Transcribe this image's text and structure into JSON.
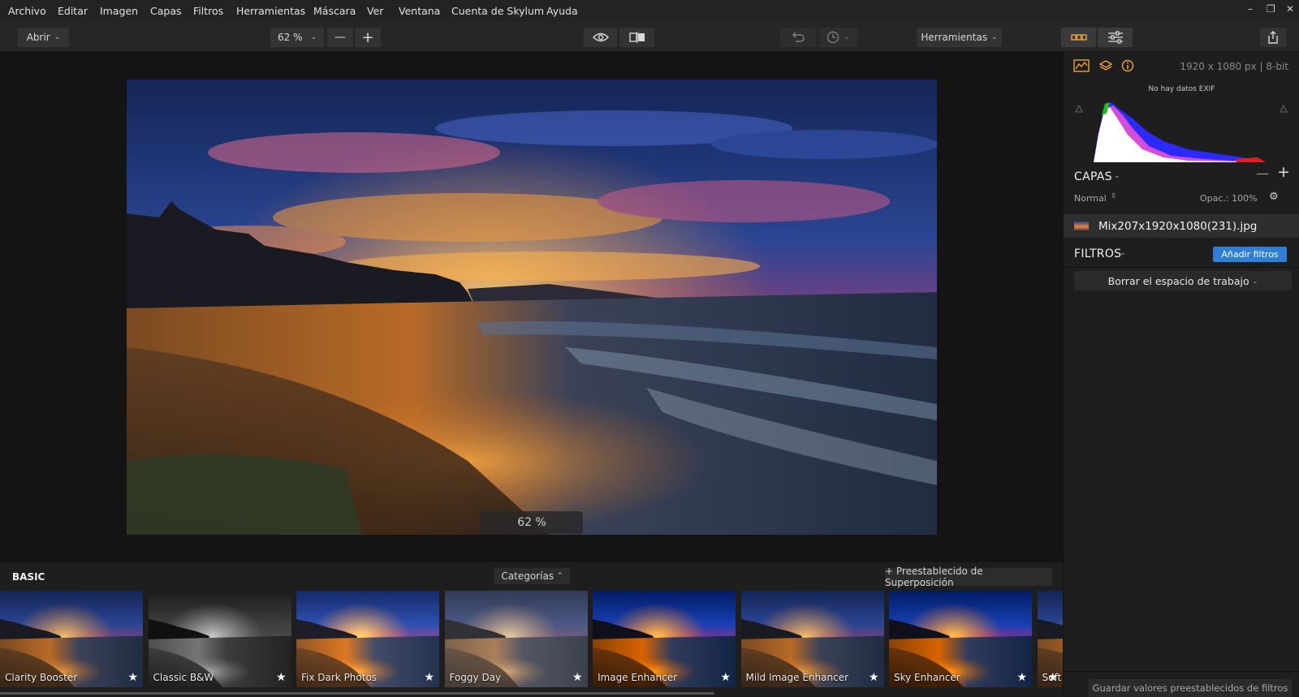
{
  "menu": {
    "items": [
      "Archivo",
      "Editar",
      "Imagen",
      "Capas",
      "Filtros",
      "Herramientas",
      "Máscara",
      "Ver",
      "Ventana",
      "Cuenta de Skylum",
      "Ayuda"
    ],
    "window_controls": [
      "–",
      "❐",
      "✕"
    ]
  },
  "toolbar": {
    "open_label": "Abrir",
    "zoom_value": "62 %",
    "zoom_out": "—",
    "zoom_in": "+",
    "tools_label": "Herramientas"
  },
  "canvas": {
    "zoom_overlay": "62 %",
    "photo_description_colors": {
      "sky_top": "#1b2f6b",
      "sunset": "#f08a2a",
      "water": "#2a3a52"
    }
  },
  "looks": {
    "category_label": "BASIC",
    "categories_button": "Categorías",
    "overlay_preset_button": "+ Preestablecido de Superposición",
    "thumbs": [
      {
        "label": "Clarity Booster",
        "variant": "normal"
      },
      {
        "label": "Classic B&W",
        "variant": "bw"
      },
      {
        "label": "Fix Dark Photos",
        "variant": "bright"
      },
      {
        "label": "Foggy Day",
        "variant": "foggy"
      },
      {
        "label": "Image Enhancer",
        "variant": "vivid"
      },
      {
        "label": "Mild Image Enhancer",
        "variant": "normal"
      },
      {
        "label": "Sky Enhancer",
        "variant": "vivid"
      },
      {
        "label": "Soft",
        "variant": "normal"
      }
    ]
  },
  "panel": {
    "image_info": "1920 x 1080 px  |  8-bit",
    "exif_text": "No hay datos EXIF",
    "layers_title": "CAPAS",
    "blend_mode": "Normal",
    "opacity": "Opac.: 100%",
    "layer_name": "Mix207x1920x1080(231).jpg",
    "filters_title": "FILTROS",
    "add_filters_button": "Añadir filtros",
    "workspace_button": "Borrar el espacio de trabajo",
    "save_preset_button": "Guardar valores preestablecidos de filtros",
    "accent_color": "#2f7fd6"
  }
}
